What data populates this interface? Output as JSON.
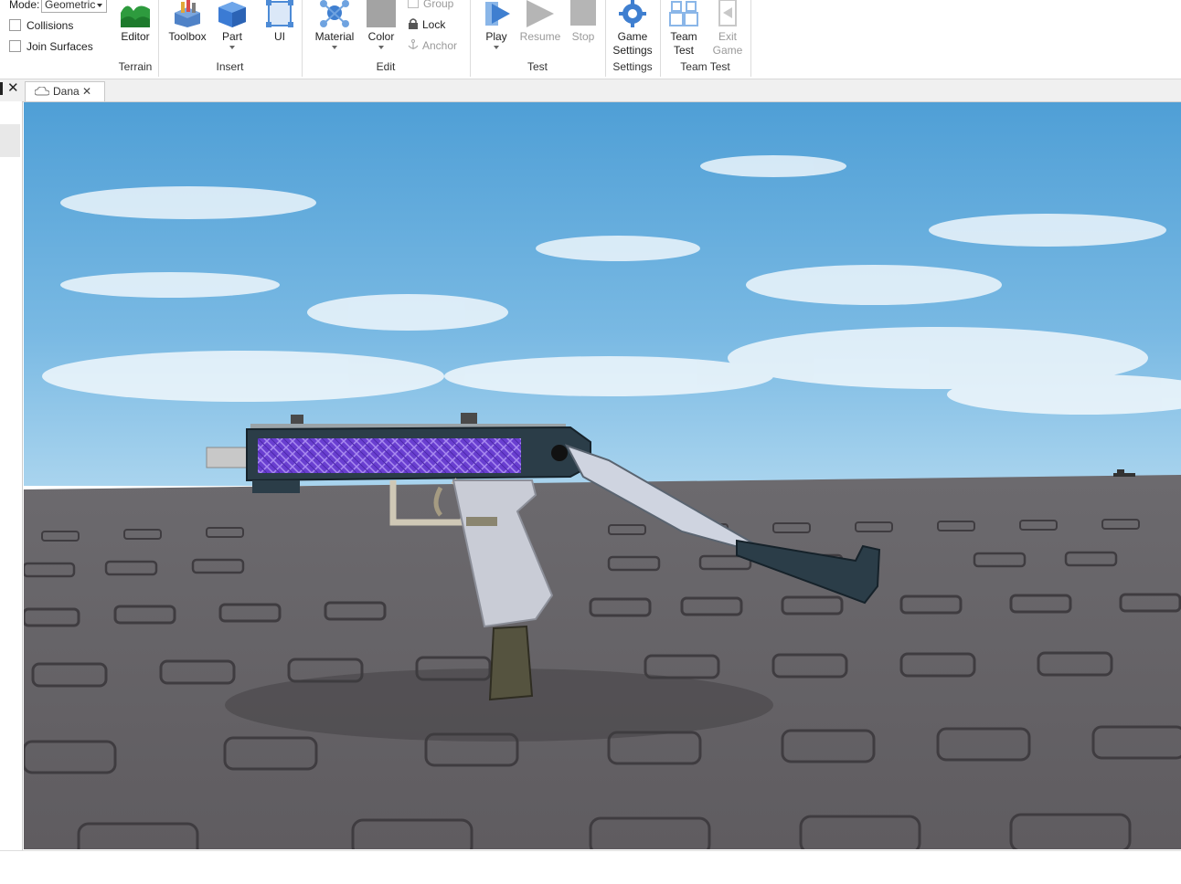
{
  "ribbon": {
    "mode_label": "Mode:",
    "mode_value": "Geometric",
    "collisions_label": "Collisions",
    "join_surfaces_label": "Join Surfaces",
    "groups": {
      "terrain": "Terrain",
      "insert": "Insert",
      "edit": "Edit",
      "test": "Test",
      "settings": "Settings",
      "team_test": "Team Test"
    },
    "tools": {
      "editor": "Editor",
      "toolbox": "Toolbox",
      "part": "Part",
      "ui": "UI",
      "material": "Material",
      "color": "Color",
      "group": "Group",
      "lock": "Lock",
      "anchor": "Anchor",
      "play": "Play",
      "resume": "Resume",
      "stop": "Stop",
      "game_settings_1": "Game",
      "game_settings_2": "Settings",
      "team_test_1": "Team",
      "team_test_2": "Test",
      "exit_game_1": "Exit",
      "exit_game_2": "Game"
    }
  },
  "tabs": {
    "place_tab": "Dana"
  },
  "colors": {
    "sky_top": "#4f9fd6",
    "sky_bottom": "#a9d4ee",
    "baseplate": "#6f6c6f",
    "stud": "#4a474a",
    "gun_body": "#2b3d48",
    "gun_panel": "#6a3fd1",
    "gun_grip": "#c9ccd6"
  }
}
